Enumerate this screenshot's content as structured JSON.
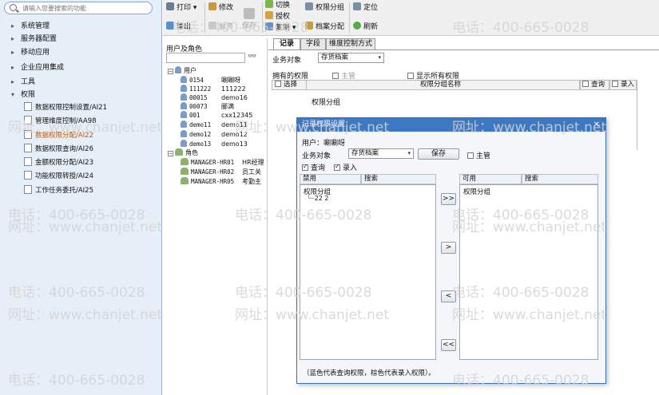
{
  "sidebar": {
    "search_placeholder": "请输入您要搜索的功能",
    "nav": [
      {
        "label": "系统管理"
      },
      {
        "label": "服务器配置"
      },
      {
        "label": "移动应用"
      },
      {
        "label": "企业应用集成"
      },
      {
        "label": "工具"
      },
      {
        "label": "权限"
      }
    ],
    "sub_items": [
      {
        "label": "数据权限控制设置/AI21"
      },
      {
        "label": "管理维度控制/AA98"
      },
      {
        "label": "数据权限分配/AI22"
      },
      {
        "label": "数据权限查询/AI26"
      },
      {
        "label": "金额权限分配/AI23"
      },
      {
        "label": "功能权限转授/AI24"
      },
      {
        "label": "工作任务委托/AI25"
      }
    ]
  },
  "toolbar": {
    "print": "打印",
    "modify": "修改",
    "switch": "切换",
    "auth_group": "权限分组",
    "locate": "定位",
    "output": "输出",
    "abandon": "放弃",
    "save": "保存",
    "grant": "授权",
    "copy": "复制",
    "archive_assign": "档案分配",
    "refresh": "刷新"
  },
  "userpanel": {
    "header": "用户及角色",
    "users_root": "用户",
    "users": [
      {
        "code": "0154",
        "name": "唰唰呀"
      },
      {
        "code": "111222",
        "name": "111222"
      },
      {
        "code": "00015",
        "name": "demo16"
      },
      {
        "code": "00073",
        "name": "郦满"
      },
      {
        "code": "001",
        "name": "cxx12345"
      },
      {
        "code": "demo11",
        "name": "demo11"
      },
      {
        "code": "demo12",
        "name": "demo12"
      },
      {
        "code": "demo13",
        "name": "demo13"
      }
    ],
    "roles_root": "角色",
    "roles": [
      {
        "code": "MANAGER-HR01",
        "name": "HR经理"
      },
      {
        "code": "MANAGER-HR02",
        "name": "员工关"
      },
      {
        "code": "MANAGER-HR05",
        "name": "考勤主"
      }
    ]
  },
  "tabs": [
    "记录",
    "字段",
    "维度控制方式"
  ],
  "main": {
    "biz_object_label": "业务对象",
    "biz_object_value": "存货档案",
    "owned_auth": "拥有的权限",
    "supervisor": "主管",
    "show_all": "显示所有权限",
    "grid_select": "选择",
    "grid_group_name": "权限分组名称",
    "grid_query": "查询",
    "grid_entry": "录入",
    "row_label": "权限分组"
  },
  "dialog": {
    "title": "记录权限设置",
    "user_label": "用户：唰唰呀",
    "biz_object_label": "业务对象",
    "biz_object_value": "存货档案",
    "save": "保存",
    "supervisor": "主管",
    "query": "查询",
    "entry": "录入",
    "forbidden_label": "禁用",
    "search_label": "搜索",
    "available_label": "可用",
    "forbidden_root": "权限分组",
    "forbidden_child": "22  2",
    "available_root": "权限分组",
    "btn_all_right": ">>",
    "btn_right": ">",
    "btn_left": "<",
    "btn_all_left": "<<",
    "note": "（蓝色代表查询权限，棕色代表录入权限）。"
  },
  "watermark": {
    "phone": "电话：400-665-0028",
    "site": "网址：www.chanjet.net"
  }
}
